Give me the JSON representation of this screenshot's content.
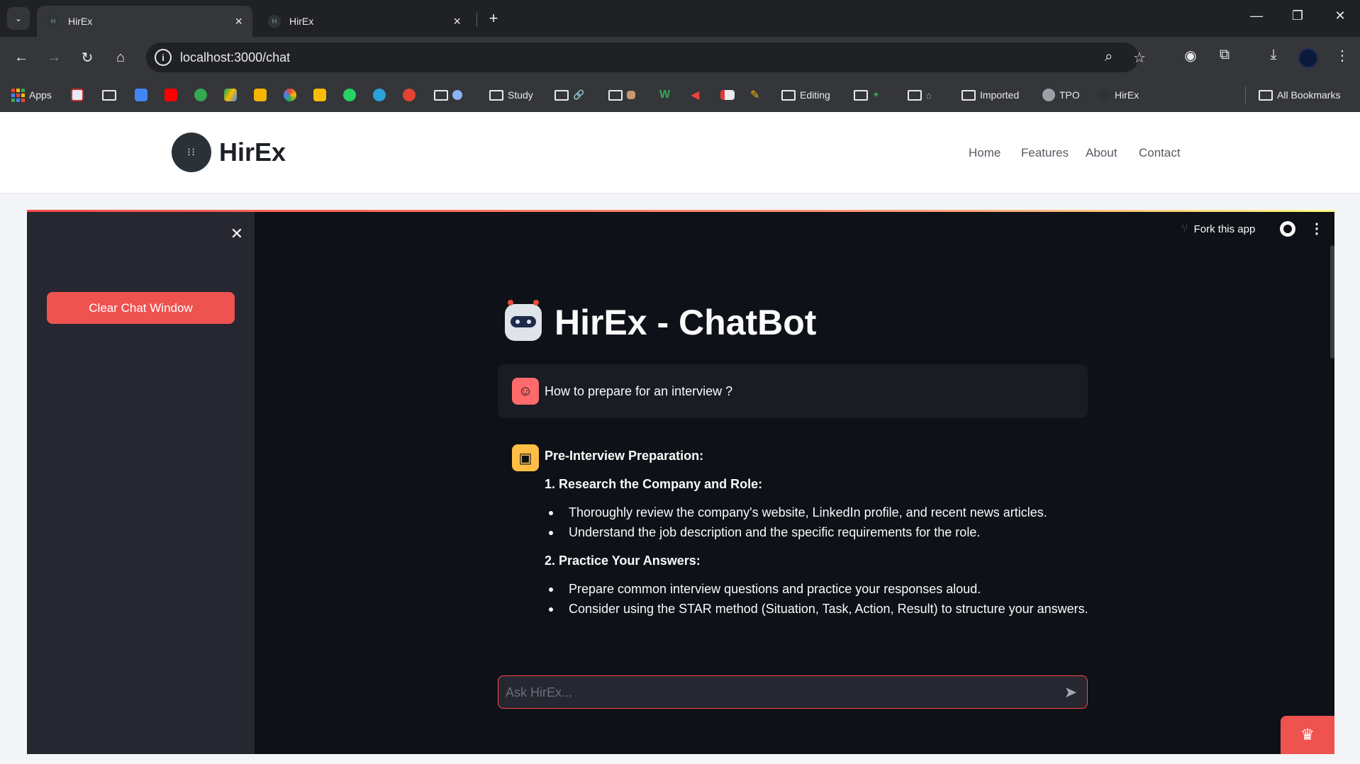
{
  "browser": {
    "tabs": [
      {
        "title": "HirEx",
        "favicon": "H",
        "active": true
      },
      {
        "title": "HirEx",
        "favicon": "H",
        "active": false
      }
    ],
    "url": "localhost:3000/chat",
    "bookmarks": [
      {
        "label": "Apps",
        "icon": "apps-grid"
      },
      {
        "label": "Study",
        "icon": "folder"
      },
      {
        "label": "Editing",
        "icon": "folder"
      },
      {
        "label": "Imported",
        "icon": "folder"
      },
      {
        "label": "TPO",
        "icon": "globe"
      },
      {
        "label": "HirEx",
        "icon": "hirex-favicon"
      },
      {
        "label": "All Bookmarks",
        "icon": "folder"
      }
    ]
  },
  "site": {
    "logo_text": "HirEx",
    "logo_glyph": "⁝⁝",
    "nav": [
      "Home",
      "Features",
      "About",
      "Contact"
    ]
  },
  "app": {
    "sidebar": {
      "clear_button": "Clear Chat Window"
    },
    "header": {
      "fork_label": "Fork this app"
    },
    "title": "HirEx - ChatBot",
    "messages": {
      "user": "How to prepare for an interview ?",
      "assistant": {
        "heading": "Pre-Interview Preparation:",
        "section1": "1. Research the Company and Role:",
        "section1_items": [
          "Thoroughly review the company's website, LinkedIn profile, and recent news articles.",
          "Understand the job description and the specific requirements for the role."
        ],
        "section2": "2. Practice Your Answers:",
        "section2_items": [
          "Prepare common interview questions and practice your responses aloud.",
          "Consider using the STAR method (Situation, Task, Action, Result) to structure your answers."
        ]
      }
    },
    "input": {
      "placeholder": "Ask HirEx..."
    }
  },
  "colors": {
    "accent": "#ff4b4b",
    "button": "#ef5350",
    "app_bg": "#0e1117",
    "sidebar_bg": "#262730",
    "bot_avatar": "#ffbd45"
  }
}
